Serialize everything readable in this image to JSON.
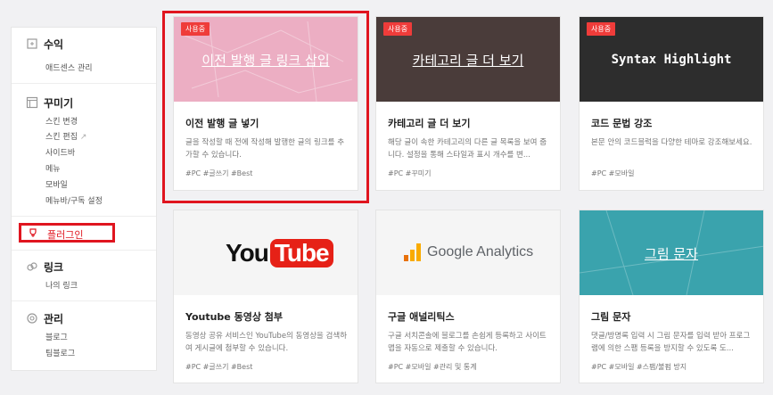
{
  "sidebar": {
    "revenue": {
      "title": "수익",
      "items": [
        "애드센스 관리"
      ]
    },
    "decorate": {
      "title": "꾸미기",
      "items": [
        "스킨 변경",
        "스킨 편집",
        "사이드바",
        "메뉴",
        "모바일",
        "메뉴바/구독 설정"
      ]
    },
    "plugin": {
      "title": "플러그인"
    },
    "link": {
      "title": "링크",
      "items": [
        "나의 링크"
      ]
    },
    "manage": {
      "title": "관리",
      "items": [
        "블로그",
        "팀블로그"
      ]
    }
  },
  "cards": [
    {
      "badge": "사용중",
      "thumb_text": "이전 발행 글 링크 삽입",
      "title": "이전 발행 글 넣기",
      "desc": "글을 작성할 때 전에 작성해 발행한 글의 링크를 추가할 수 있습니다.",
      "tags": "#PC  #글쓰기  #Best"
    },
    {
      "badge": "사용중",
      "thumb_text": "카테고리 글 더 보기",
      "title": "카테고리 글 더 보기",
      "desc": "해당 글이 속한 카테고리의 다른 글 목록을 보여 줍니다. 설정을 통해 스타일과 표시 개수를 변...",
      "tags": "#PC  #꾸미기"
    },
    {
      "badge": "사용중",
      "thumb_text": "Syntax Highlight",
      "title": "코드 문법 강조",
      "desc": "본문 안의 코드블럭을 다양한 테마로 강조해보세요.",
      "tags": "#PC  #모바일"
    },
    {
      "badge": "",
      "thumb_text": "YouTube",
      "title": "Youtube 동영상 첨부",
      "desc": "동영상 공유 서비스인 YouTube의 동영상을 검색하여 게시글에 첨부할 수 있습니다.",
      "tags": "#PC  #글쓰기  #Best"
    },
    {
      "badge": "",
      "thumb_text": "Google Analytics",
      "title": "구글 애널리틱스",
      "desc": "구글 서치콘솔에 블로그를 손쉽게 등록하고 사이트맵을 자동으로 제출할 수 있습니다.",
      "tags": "#PC  #모바일  #관리 및 통계"
    },
    {
      "badge": "",
      "thumb_text": "그림 문자",
      "title": "그림 문자",
      "desc": "댓글/방명록 입력 시 그림 문자를 입력 받아 프로그램에 의한 스팸 등록을 방지할 수 있도록 도...",
      "tags": "#PC  #모바일  #스팸/불펌 방지"
    }
  ],
  "colors": {
    "accent": "#e0151f",
    "badge": "#ef3c3a"
  }
}
